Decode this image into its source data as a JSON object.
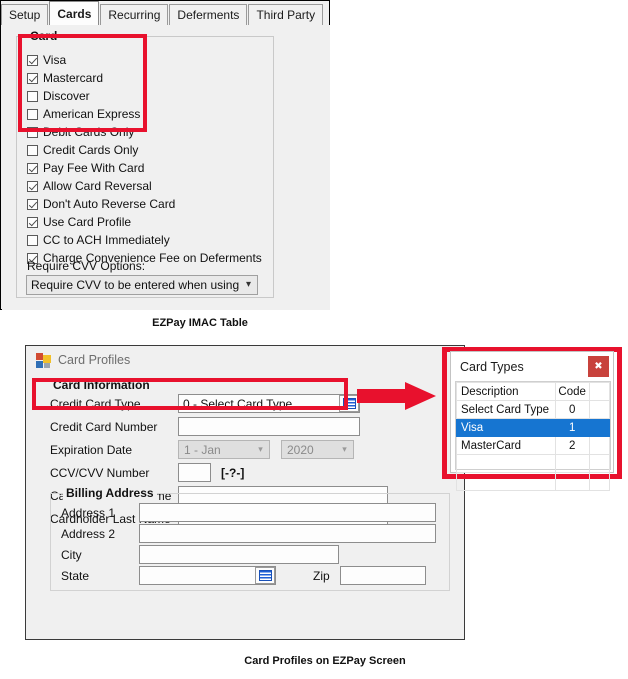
{
  "imac_panel": {
    "tabs": [
      {
        "label": "Setup",
        "active": false
      },
      {
        "label": "Cards",
        "active": true
      },
      {
        "label": "Recurring",
        "active": false
      },
      {
        "label": "Deferments",
        "active": false
      },
      {
        "label": "Third Party",
        "active": false
      }
    ],
    "group_title": "Card",
    "checkboxes": [
      {
        "label": "Visa",
        "checked": true
      },
      {
        "label": "Mastercard",
        "checked": true
      },
      {
        "label": "Discover",
        "checked": false
      },
      {
        "label": "American Express",
        "checked": false
      },
      {
        "label": "Debit Cards Only",
        "checked": false
      },
      {
        "label": "Credit Cards Only",
        "checked": false
      },
      {
        "label": "Pay Fee With Card",
        "checked": true
      },
      {
        "label": "Allow Card Reversal",
        "checked": true
      },
      {
        "label": "Don't Auto Reverse Card",
        "checked": true
      },
      {
        "label": "Use Card Profile",
        "checked": true
      },
      {
        "label": "CC to ACH Immediately",
        "checked": false
      },
      {
        "label": "Charge Convenience Fee on Deferments",
        "checked": true
      }
    ],
    "cvv_label": "Require CVV Options:",
    "cvv_value": "Require CVV to be entered when using token:"
  },
  "captions": {
    "imac": "EZPay IMAC Table",
    "profiles": "Card Profiles on EZPay Screen"
  },
  "card_profiles": {
    "window_title": "Card Profiles",
    "card_info_title": "Card Information",
    "fields": {
      "credit_card_type_label": "Credit Card Type",
      "credit_card_type_value": "0 - Select Card Type",
      "credit_card_number_label": "Credit Card Number",
      "credit_card_number_value": "",
      "expiration_date_label": "Expiration Date",
      "expiration_month_value": "1 - Jan",
      "expiration_year_value": "2020",
      "ccv_label": "CCV/CVV Number",
      "ccv_value": "",
      "ccv_hint": "[-?-]",
      "first_name_label": "Cardholder First Name",
      "first_name_value": "",
      "last_name_label": "Cardholder Last Name",
      "last_name_value": ""
    },
    "billing": {
      "title": "Billing Address",
      "address1_label": "Address 1",
      "address1_value": "",
      "address2_label": "Address 2",
      "address2_value": "",
      "city_label": "City",
      "city_value": "",
      "state_label": "State",
      "state_value": "",
      "zip_label": "Zip",
      "zip_value": ""
    }
  },
  "card_types": {
    "title": "Card Types",
    "close_label": "✖",
    "columns": [
      "Description",
      "Code"
    ],
    "rows": [
      {
        "description": "Select Card Type",
        "code": "0",
        "selected": false
      },
      {
        "description": "Visa",
        "code": "1",
        "selected": true
      },
      {
        "description": "MasterCard",
        "code": "2",
        "selected": false
      },
      {
        "description": "",
        "code": "",
        "selected": false
      },
      {
        "description": "",
        "code": "",
        "selected": false
      }
    ]
  },
  "colors": {
    "callout_red": "#e8112d",
    "selection_blue": "#1675d1",
    "close_red": "#c8423c"
  }
}
